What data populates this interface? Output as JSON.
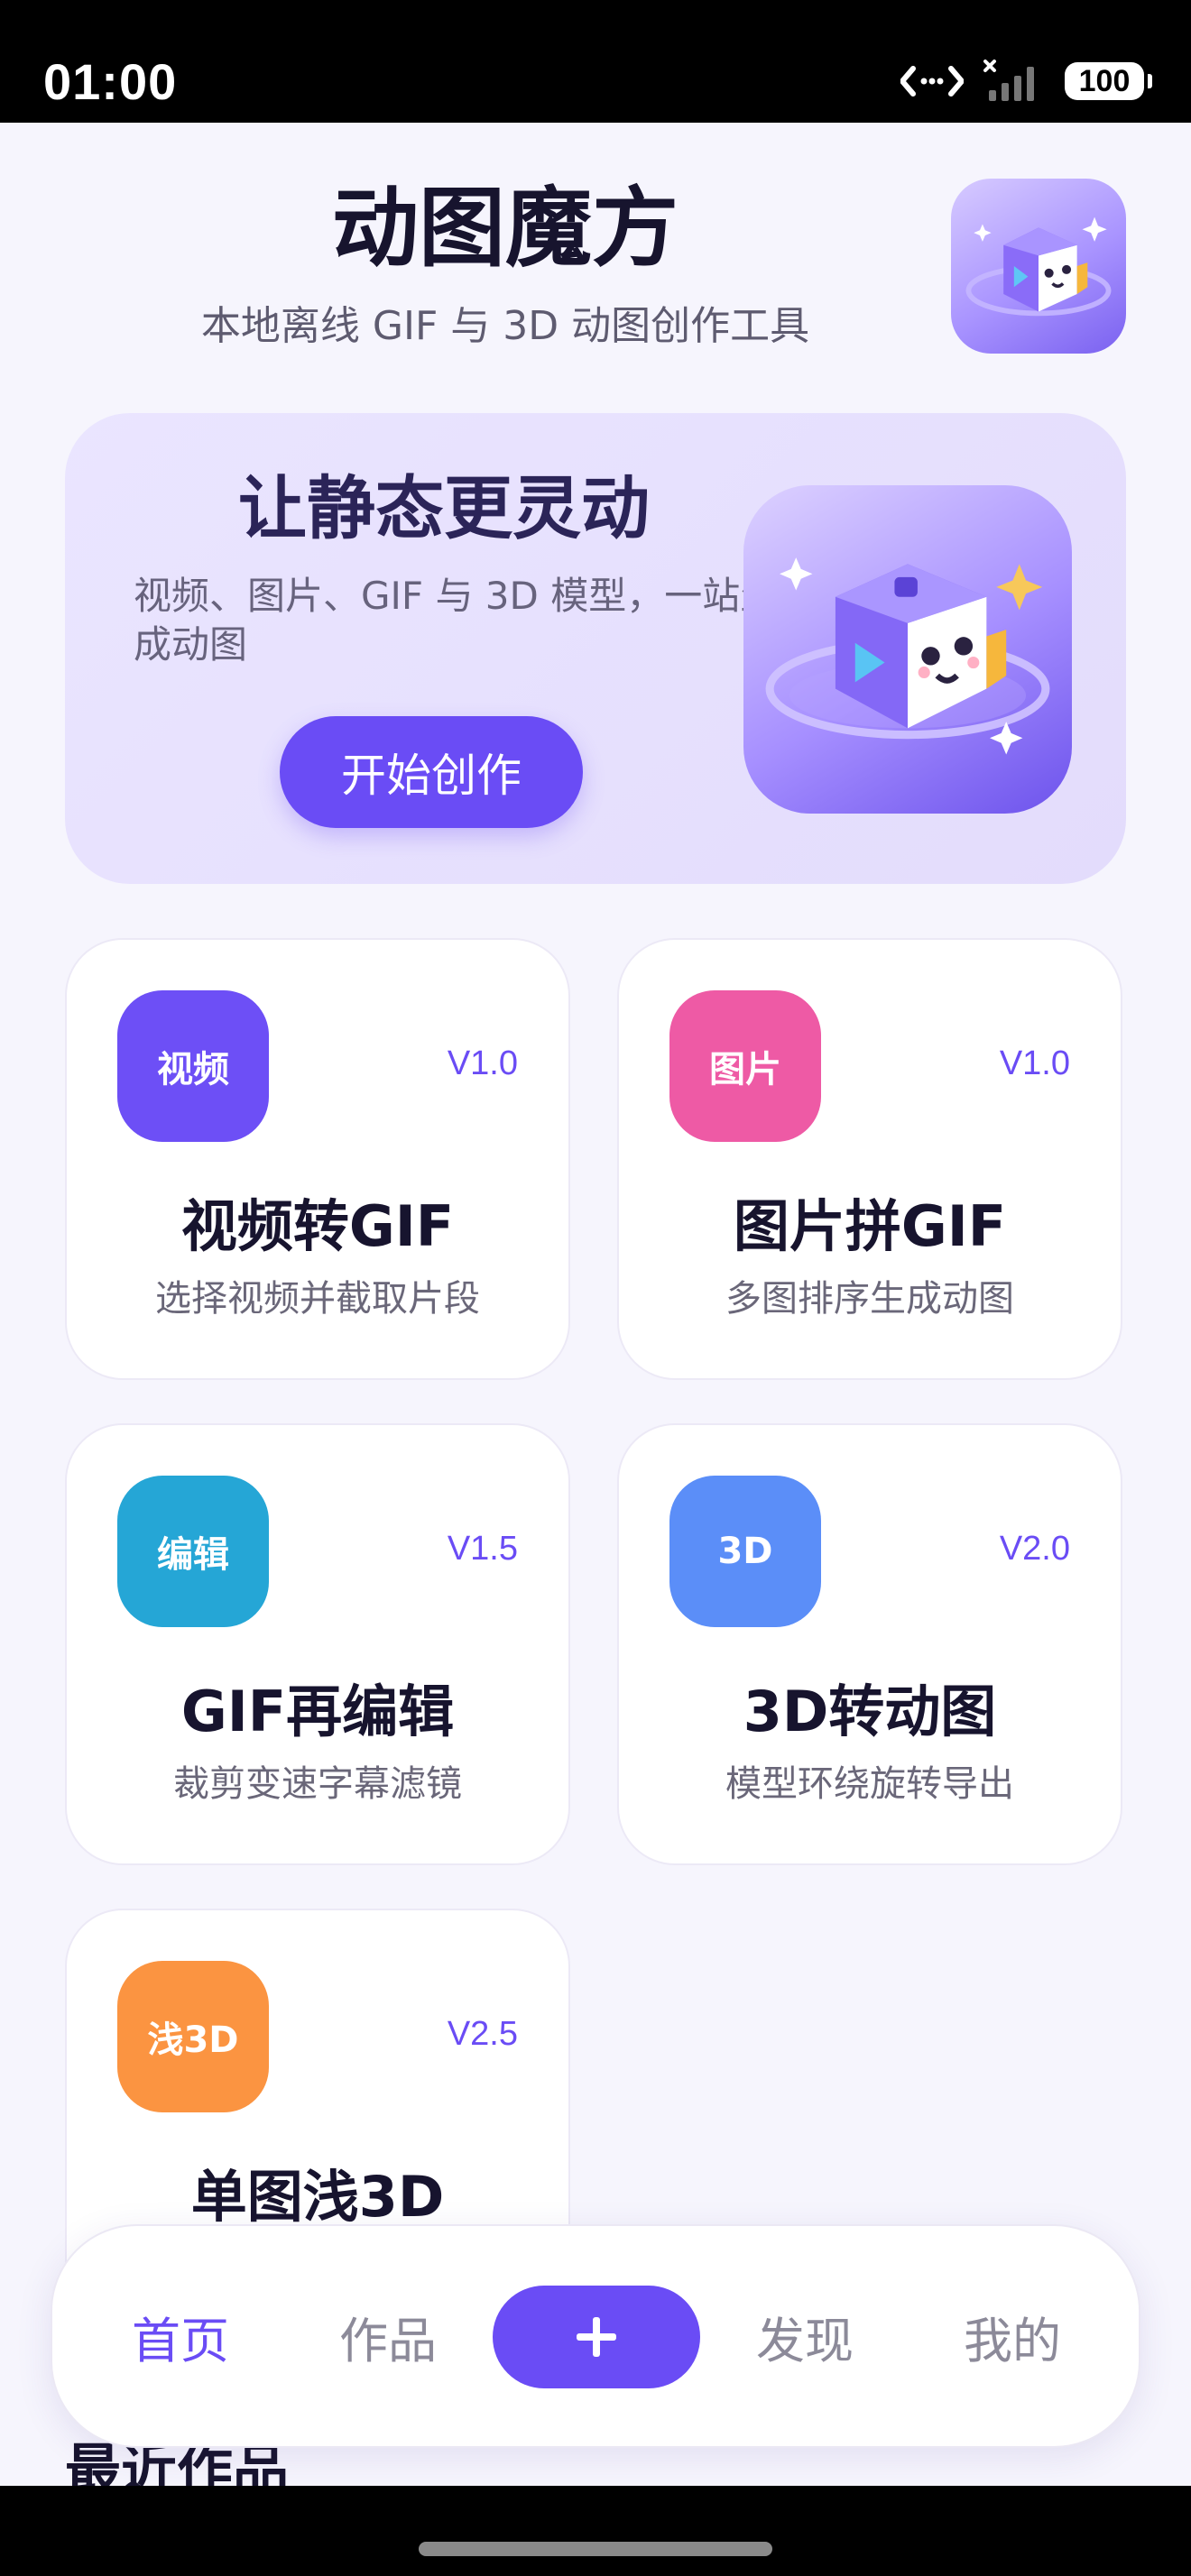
{
  "status_bar": {
    "time": "01:00",
    "battery": "100",
    "icons": [
      "data-arrows-icon",
      "signal-icon",
      "battery-icon"
    ]
  },
  "header": {
    "title": "动图魔方",
    "subtitle": "本地离线 GIF 与 3D 动图创作工具",
    "logo_icon": "cube-mascot-icon"
  },
  "hero": {
    "title": "让静态更灵动",
    "description": "视频、图片、GIF 与 3D 模型，一站生成动图",
    "button_label": "开始创作",
    "image_icon": "cube-mascot-icon"
  },
  "tools": [
    {
      "badge": "视频",
      "version": "V1.0",
      "name": "视频转GIF",
      "desc": "选择视频并截取片段",
      "color": "#6d4ff6"
    },
    {
      "badge": "图片",
      "version": "V1.0",
      "name": "图片拼GIF",
      "desc": "多图排序生成动图",
      "color": "#ee5aa5"
    },
    {
      "badge": "编辑",
      "version": "V1.5",
      "name": "GIF再编辑",
      "desc": "裁剪变速字幕滤镜",
      "color": "#25a6d6"
    },
    {
      "badge": "3D",
      "version": "V2.0",
      "name": "3D转动图",
      "desc": "模型环绕旋转导出",
      "color": "#5b8ef8"
    },
    {
      "badge": "浅3D",
      "version": "V2.5",
      "name": "单图浅3D",
      "desc": "",
      "color": "#fb9441"
    }
  ],
  "recent": {
    "title": "最近作品"
  },
  "tab_bar": {
    "items": [
      "首页",
      "作品",
      "发现",
      "我的"
    ],
    "active": "首页",
    "add_icon": "plus-icon",
    "accent": "#6a4cf5"
  }
}
